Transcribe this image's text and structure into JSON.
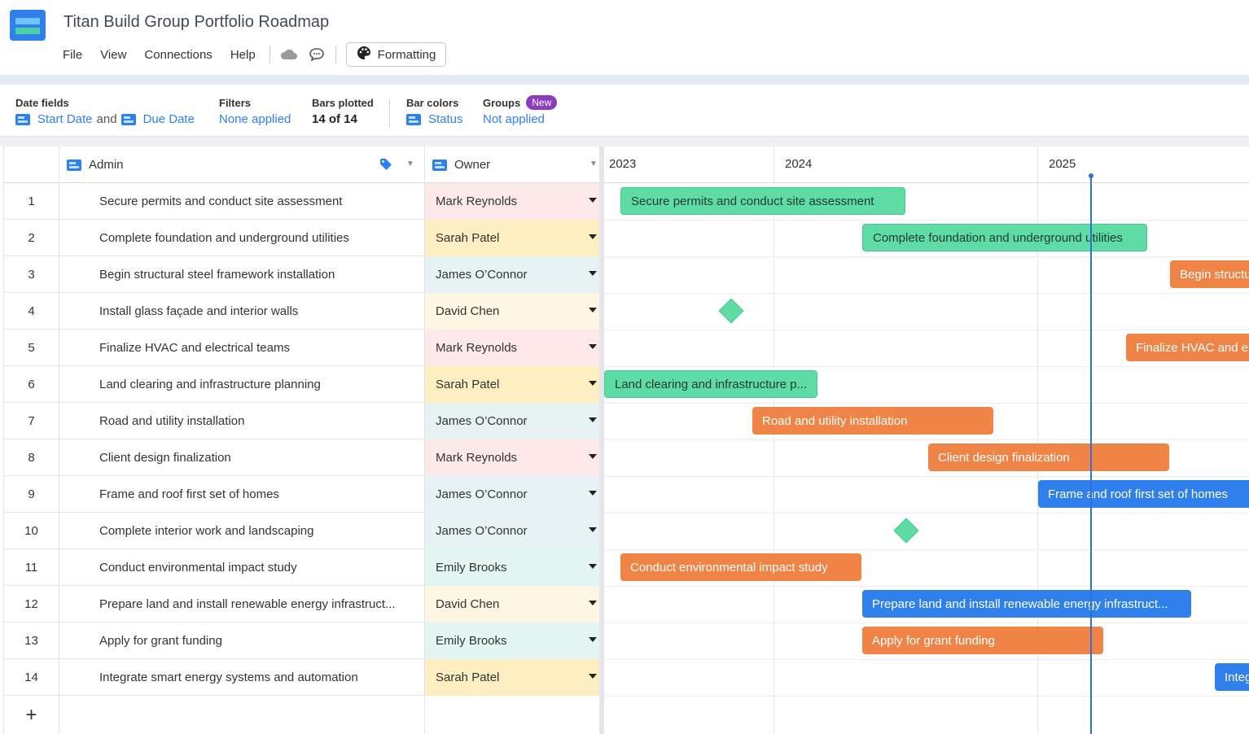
{
  "app": {
    "title": "Titan Build Group Portfolio Roadmap"
  },
  "menu": {
    "file": "File",
    "view": "View",
    "connections": "Connections",
    "help": "Help",
    "formatting": "Formatting"
  },
  "options": {
    "date_fields": {
      "label": "Date fields",
      "start": "Start Date",
      "joiner": "and",
      "due": "Due Date"
    },
    "filters": {
      "label": "Filters",
      "value": "None applied"
    },
    "bars_plotted": {
      "label": "Bars plotted",
      "value": "14 of 14"
    },
    "bar_colors": {
      "label": "Bar colors",
      "value": "Status"
    },
    "groups": {
      "label": "Groups",
      "badge": "New",
      "value": "Not applied"
    }
  },
  "grid": {
    "columns": {
      "task": "Admin",
      "owner": "Owner"
    },
    "rows": [
      {
        "num": "1",
        "task": "Secure permits and conduct site assessment",
        "owner": "Mark Reynolds",
        "owner_color": "#fde9ea"
      },
      {
        "num": "2",
        "task": "Complete foundation and underground utilities",
        "owner": "Sarah Patel",
        "owner_color": "#fdefc2"
      },
      {
        "num": "3",
        "task": "Begin structural steel framework installation",
        "owner": "James O’Connor",
        "owner_color": "#e6f2f3"
      },
      {
        "num": "4",
        "task": "Install glass façade and interior walls",
        "owner": "David Chen",
        "owner_color": "#fdf6e3"
      },
      {
        "num": "5",
        "task": "Finalize HVAC and electrical teams",
        "owner": "Mark Reynolds",
        "owner_color": "#fde9ea"
      },
      {
        "num": "6",
        "task": "Land clearing and infrastructure planning",
        "owner": "Sarah Patel",
        "owner_color": "#fdefc2"
      },
      {
        "num": "7",
        "task": "Road and utility installation",
        "owner": "James O’Connor",
        "owner_color": "#e6f2f3"
      },
      {
        "num": "8",
        "task": "Client design finalization",
        "owner": "Mark Reynolds",
        "owner_color": "#fde9ea"
      },
      {
        "num": "9",
        "task": "Frame and roof first set of homes",
        "owner": "James O’Connor",
        "owner_color": "#e6f2f3"
      },
      {
        "num": "10",
        "task": "Complete interior work and landscaping",
        "owner": "James O’Connor",
        "owner_color": "#e6f2f3"
      },
      {
        "num": "11",
        "task": "Conduct environmental impact study",
        "owner": "Emily Brooks",
        "owner_color": "#e3f6f1"
      },
      {
        "num": "12",
        "task": "Prepare land and install renewable energy infrastruct...",
        "owner": "David Chen",
        "owner_color": "#fdf6e3"
      },
      {
        "num": "13",
        "task": "Apply for grant funding",
        "owner": "Emily Brooks",
        "owner_color": "#e3f6f1"
      },
      {
        "num": "14",
        "task": "Integrate smart energy systems and automation",
        "owner": "Sarah Patel",
        "owner_color": "#fdefc2"
      }
    ],
    "add_label": "+"
  },
  "timeline": {
    "years": [
      "2023",
      "2024",
      "2025"
    ],
    "bars": [
      {
        "row": 1,
        "label": "Secure permits and conduct site assessment",
        "status_color": "green"
      },
      {
        "row": 2,
        "label": "Complete foundation and underground utilities",
        "status_color": "green"
      },
      {
        "row": 3,
        "label": "Begin structu",
        "status_color": "orange"
      },
      {
        "row": 5,
        "label": "Finalize HVAC and e",
        "status_color": "orange"
      },
      {
        "row": 6,
        "label": "Land clearing and infrastructure p...",
        "status_color": "green"
      },
      {
        "row": 7,
        "label": "Road and utility installation",
        "status_color": "orange"
      },
      {
        "row": 8,
        "label": "Client design finalization",
        "status_color": "orange"
      },
      {
        "row": 9,
        "label": "Frame and roof first set of homes",
        "status_color": "blue"
      },
      {
        "row": 11,
        "label": "Conduct environmental impact study",
        "status_color": "orange"
      },
      {
        "row": 12,
        "label": "Prepare land and install renewable energy infrastruct...",
        "status_color": "blue"
      },
      {
        "row": 13,
        "label": "Apply for grant funding",
        "status_color": "orange"
      },
      {
        "row": 14,
        "label": "Integ",
        "status_color": "blue"
      }
    ],
    "milestones": [
      {
        "row": 4,
        "status_color": "green"
      },
      {
        "row": 10,
        "status_color": "green"
      }
    ]
  },
  "colors": {
    "accent": "#2f80ed",
    "green": "#5fdba5",
    "orange": "#f08447",
    "blue": "#2f80ed",
    "badge_purple": "#8b3dbf"
  }
}
